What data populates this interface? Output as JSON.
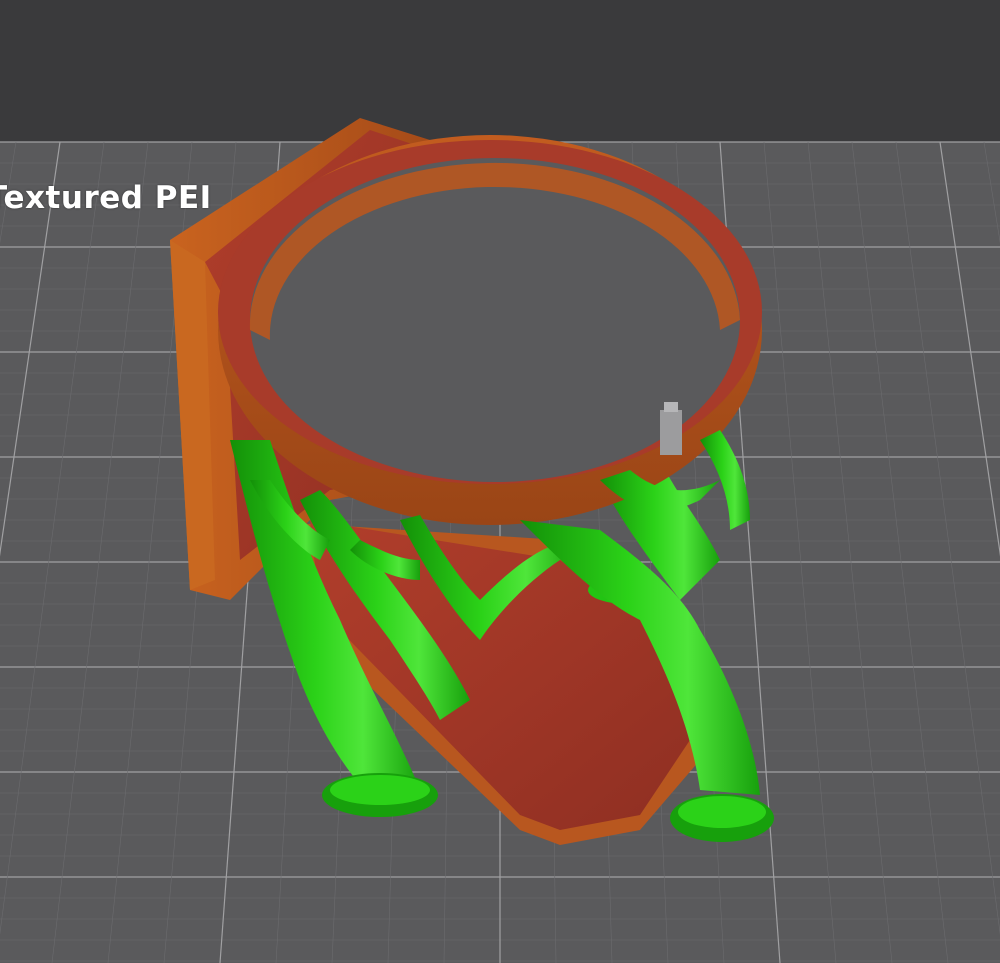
{
  "viewport": {
    "bed_label": "Textured PEI",
    "colors": {
      "background": "#3a3a3c",
      "bed": "#5a5a5c",
      "grid_minor": "#6b6b6e",
      "grid_major": "#a0a0a2",
      "model_wall": "#b8571f",
      "model_top": "#a83b2a",
      "support": "#22c413",
      "support_dark": "#139008",
      "support_light": "#4fe63a"
    },
    "icons": [
      "support-tree-icon",
      "model-part-icon"
    ]
  }
}
